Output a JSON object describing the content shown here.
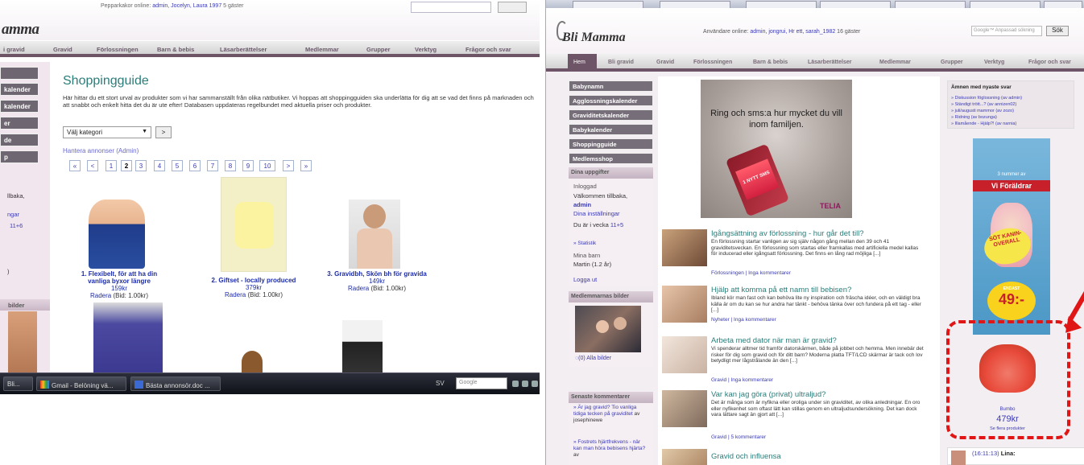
{
  "left": {
    "topline_prefix": "Pepparkakor online: ",
    "topline_users": "admin, Jocelyn, Laura 1997",
    "topline_suffix": " 5 gäster",
    "logo": "amma",
    "nav": [
      "i gravid",
      "Gravid",
      "Förlossningen",
      "Barn & bebis",
      "Läsarberättelser",
      "Medlemmar",
      "Grupper",
      "Verktyg",
      "Frågor och svar"
    ],
    "side_buttons": [
      "",
      "kalender",
      "kalender",
      "er",
      "de",
      "p"
    ],
    "side_text": [
      "llbaka,",
      "ngar",
      "11+6",
      ")"
    ],
    "side_box": "bilder",
    "title": "Shoppingguide",
    "intro": "Här hittar du ett stort urval av produkter som vi har sammanställt från olika nätbutiker. Vi hoppas att shoppingguiden ska underlätta för dig att se vad det finns på marknaden och att snabbt och enkelt hitta det du är ute efter! Databasen uppdateras regelbundet med aktuella priser och produkter.",
    "select_value": "Välj kategori",
    "go": ">",
    "admin_link": "Hantera annonser (Admin)",
    "pages": [
      "«",
      "<",
      "1",
      "2",
      "3",
      "4",
      "5",
      "6",
      "7",
      "8",
      "9",
      "10",
      ">",
      "»"
    ],
    "current_page": "2",
    "products": [
      {
        "title": "1. Flexibelt, för att ha din vanliga byxor längre",
        "price": "159kr",
        "remove": "Radera",
        "bid": " (Bid: 1.00kr)"
      },
      {
        "title": "2. Giftset - locally produced",
        "price": "379kr",
        "remove": "Radera",
        "bid": " (Bid: 1.00kr)"
      },
      {
        "title": "3. Gravidbh, Skön bh för gravida",
        "price": "149kr",
        "remove": "Radera",
        "bid": " (Bid: 1.00kr)"
      }
    ]
  },
  "taskbar": {
    "items": [
      "Bli...",
      "Gmail - Belöning vä...",
      "Bästa annonsör.doc ..."
    ],
    "lang": "SV",
    "search": "Google"
  },
  "right": {
    "tabs": [
      "",
      "",
      "",
      "",
      "",
      "",
      ""
    ],
    "online_prefix": "Användare online: ",
    "online_users": "admin, jongrui, Hr ett, sarah_1982",
    "online_suffix": " 16 gäster",
    "search_placeholder": "Google™ Anpassad sökning",
    "search_button": "Sök",
    "logo": "Bli Mamma",
    "nav_home": "Hem",
    "nav": [
      "Bli gravid",
      "Gravid",
      "Förlossningen",
      "Barn & bebis",
      "Läsarberättelser",
      "Medlemmar",
      "Grupper",
      "Verktyg",
      "Frågor och svar"
    ],
    "side_buttons": [
      "Babynamn",
      "Agglossningskalender",
      "Graviditetskalender",
      "Babykalender",
      "Shoppingguide",
      "Medlemsshop"
    ],
    "my_info_title": "Dina uppgifter",
    "logged_in": "Inloggad",
    "welcome": "Välkommen tillbaka,",
    "user": "admin",
    "settings": "Dina inställningar",
    "week_prefix": "Du är i vecka ",
    "week": "11+5",
    "stats": "» Statistik",
    "my_kids": "Mina barn",
    "kid": "Martin (1.2 år)",
    "logout": "Logga ut",
    "members_pics": "Medlemmarnas bilder",
    "all_pics": "(0) Alla bilder",
    "latest_comments": "Senaste kommentarer",
    "comments": [
      {
        "link": "» Är jag gravid? Tio vanliga tidiga tecken på graviditet",
        "by": " av josephinewe"
      },
      {
        "link": "» Fostrets hjärtfrekvens - när kan man höra bebisens hjärta?",
        "by": " av"
      }
    ],
    "ad_text": "Ring och sms:a hur mycket du vill inom familjen.",
    "ad_sms": "1 NYTT SMS",
    "ad_brand": "TELIA",
    "articles": [
      {
        "title": "Igångsättning av förlossning - hur går det till?",
        "body": "En förlossning startar vanligen av sig själv någon gång mellan den 39 och 41 graviditetsveckan. En förlossning som startas eller framkallas med artificiella medel kallas för inducerad eller igångsatt förlossning. Det finns en lång rad möjliga [...]",
        "meta": "Förlossningen | Inga kommentarer"
      },
      {
        "title": "Hjälp att komma på ett namn till bebisen?",
        "body": "Ibland kör man fast och kan behöva lite ny inspiration och fräscha idéer, och en väldigt bra källa är om du kan se hur andra har tänkt - behöva tänka över och fundera på ett tag - eller [...]",
        "meta": "Nyheter | Inga kommentarer"
      },
      {
        "title": "Arbeta med dator när man är gravid?",
        "body": "Vi spenderar alltmer tid framför datorskärmen, både på jobbet och hemma. Men innebär det risker för dig som gravid och för ditt barn? Moderna platta TFT/LCD skärmar är tack och lov betydligt mer lågstrålande än den [...]",
        "meta": "Gravid | Inga kommentarer"
      },
      {
        "title": "Var kan jag göra (privat) ultraljud?",
        "body": "Det är många som är nyfikna eller oroliga under sin graviditet, av olika anledningar. En oro eller nyfikenhet som oftast lätt kan stillas genom en ultraljudsundersökning. Det kan dock vara lättare sagt än gjort att [...]",
        "meta": "Gravid | 5 kommentarer"
      },
      {
        "title": "Gravid och influensa",
        "body": "",
        "meta": ""
      }
    ],
    "forum_title": "Ämnen med nyaste svar",
    "forum": [
      "» Diskussion föglossning (av admin)",
      "» Ständigt trött...? (av annizen02)",
      "» juli/augusti mammor (av zozo)",
      "» Ridning (av bozunga)",
      "» Illamående - Hjälp?! (av narnia)"
    ],
    "mag_brand": "Vi Föräldrar",
    "mag_issues": "3 nummer av",
    "mag_burst": "SÖT KANIN-OVERALL",
    "mag_only": "ENDAST",
    "mag_price": "49:-",
    "product_name": "Bumbo",
    "product_price": "479kr",
    "more_products": "Se flera produkter",
    "chat_time": "(16:11:13)",
    "chat_user": "Lina:"
  }
}
